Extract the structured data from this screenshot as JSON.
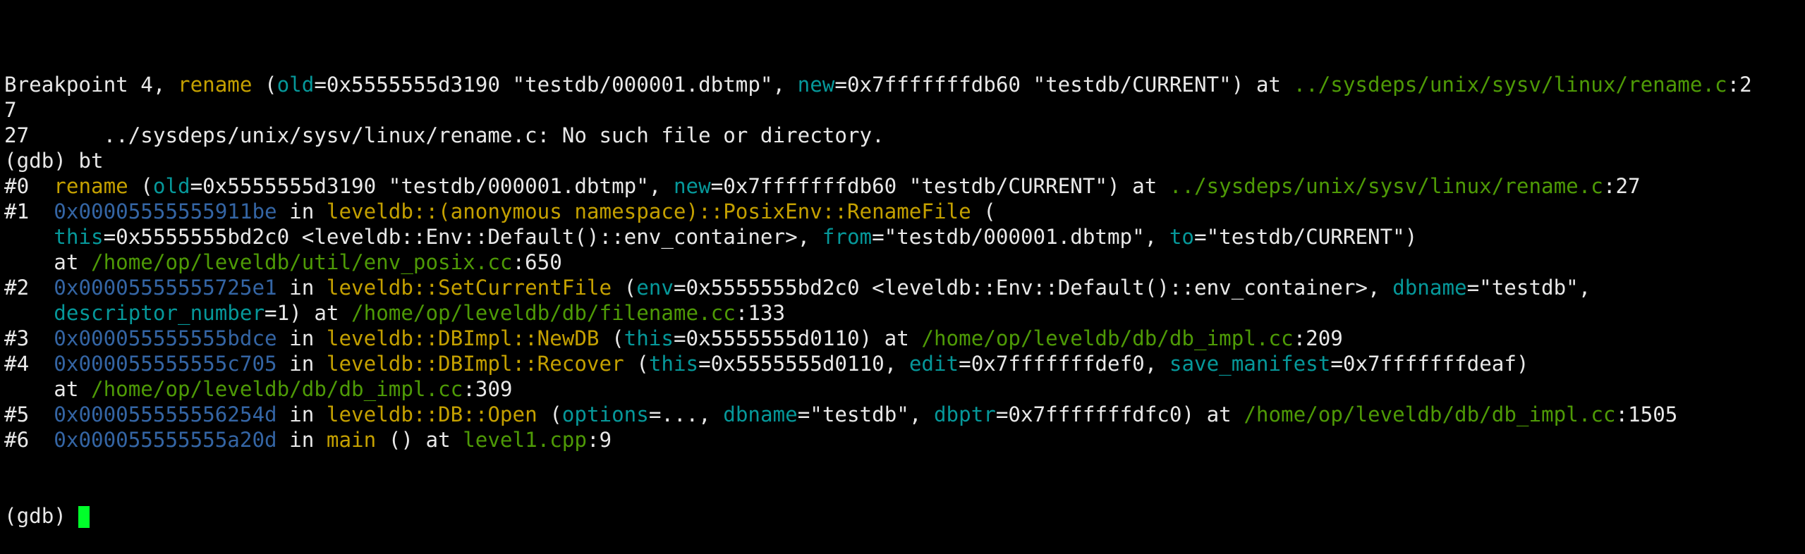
{
  "terminal": {
    "lines": [
      [
        {
          "t": "Breakpoint 4, ",
          "c": "plain"
        },
        {
          "t": "rename",
          "c": "fn"
        },
        {
          "t": " (",
          "c": "plain"
        },
        {
          "t": "old",
          "c": "arg"
        },
        {
          "t": "=0x5555555d3190 \"testdb/000001.dbtmp\", ",
          "c": "plain"
        },
        {
          "t": "new",
          "c": "arg"
        },
        {
          "t": "=0x7fffffffdb60 \"testdb/CURRENT\") at ",
          "c": "plain"
        },
        {
          "t": "../sysdeps/unix/sysv/linux/rename.c",
          "c": "file"
        },
        {
          "t": ":2",
          "c": "plain"
        }
      ],
      [
        {
          "t": "7",
          "c": "plain"
        }
      ],
      [
        {
          "t": "27\t../sysdeps/unix/sysv/linux/rename.c: No such file or directory.",
          "c": "plain"
        }
      ],
      [
        {
          "t": "(gdb) bt",
          "c": "plain"
        }
      ],
      [
        {
          "t": "#0  ",
          "c": "plain"
        },
        {
          "t": "rename",
          "c": "fn"
        },
        {
          "t": " (",
          "c": "plain"
        },
        {
          "t": "old",
          "c": "arg"
        },
        {
          "t": "=0x5555555d3190 \"testdb/000001.dbtmp\", ",
          "c": "plain"
        },
        {
          "t": "new",
          "c": "arg"
        },
        {
          "t": "=0x7fffffffdb60 \"testdb/CURRENT\") at ",
          "c": "plain"
        },
        {
          "t": "../sysdeps/unix/sysv/linux/rename.c",
          "c": "file"
        },
        {
          "t": ":27",
          "c": "plain"
        }
      ],
      [
        {
          "t": "#1  ",
          "c": "plain"
        },
        {
          "t": "0x00005555555911be",
          "c": "addr"
        },
        {
          "t": " in ",
          "c": "plain"
        },
        {
          "t": "leveldb::(anonymous namespace)::PosixEnv::RenameFile",
          "c": "fn"
        },
        {
          "t": " (",
          "c": "plain"
        }
      ],
      [
        {
          "t": "    ",
          "c": "plain"
        },
        {
          "t": "this",
          "c": "arg"
        },
        {
          "t": "=0x5555555bd2c0 <leveldb::Env::Default()::env_container>, ",
          "c": "plain"
        },
        {
          "t": "from",
          "c": "arg"
        },
        {
          "t": "=\"testdb/000001.dbtmp\", ",
          "c": "plain"
        },
        {
          "t": "to",
          "c": "arg"
        },
        {
          "t": "=\"testdb/CURRENT\")",
          "c": "plain"
        }
      ],
      [
        {
          "t": "    at ",
          "c": "plain"
        },
        {
          "t": "/home/op/leveldb/util/env_posix.cc",
          "c": "file"
        },
        {
          "t": ":650",
          "c": "plain"
        }
      ],
      [
        {
          "t": "#2  ",
          "c": "plain"
        },
        {
          "t": "0x00005555555725e1",
          "c": "addr"
        },
        {
          "t": " in ",
          "c": "plain"
        },
        {
          "t": "leveldb::SetCurrentFile",
          "c": "fn"
        },
        {
          "t": " (",
          "c": "plain"
        },
        {
          "t": "env",
          "c": "arg"
        },
        {
          "t": "=0x5555555bd2c0 <leveldb::Env::Default()::env_container>, ",
          "c": "plain"
        },
        {
          "t": "dbname",
          "c": "arg"
        },
        {
          "t": "=\"testdb\",",
          "c": "plain"
        }
      ],
      [
        {
          "t": "    ",
          "c": "plain"
        },
        {
          "t": "descriptor_number",
          "c": "arg"
        },
        {
          "t": "=1) at ",
          "c": "plain"
        },
        {
          "t": "/home/op/leveldb/db/filename.cc",
          "c": "file"
        },
        {
          "t": ":133",
          "c": "plain"
        }
      ],
      [
        {
          "t": "#3  ",
          "c": "plain"
        },
        {
          "t": "0x000055555555bdce",
          "c": "addr"
        },
        {
          "t": " in ",
          "c": "plain"
        },
        {
          "t": "leveldb::DBImpl::NewDB",
          "c": "fn"
        },
        {
          "t": " (",
          "c": "plain"
        },
        {
          "t": "this",
          "c": "arg"
        },
        {
          "t": "=0x5555555d0110) at ",
          "c": "plain"
        },
        {
          "t": "/home/op/leveldb/db/db_impl.cc",
          "c": "file"
        },
        {
          "t": ":209",
          "c": "plain"
        }
      ],
      [
        {
          "t": "#4  ",
          "c": "plain"
        },
        {
          "t": "0x000055555555c705",
          "c": "addr"
        },
        {
          "t": " in ",
          "c": "plain"
        },
        {
          "t": "leveldb::DBImpl::Recover",
          "c": "fn"
        },
        {
          "t": " (",
          "c": "plain"
        },
        {
          "t": "this",
          "c": "arg"
        },
        {
          "t": "=0x5555555d0110, ",
          "c": "plain"
        },
        {
          "t": "edit",
          "c": "arg"
        },
        {
          "t": "=0x7fffffffdef0, ",
          "c": "plain"
        },
        {
          "t": "save_manifest",
          "c": "arg"
        },
        {
          "t": "=0x7fffffffdeaf)",
          "c": "plain"
        }
      ],
      [
        {
          "t": "    at ",
          "c": "plain"
        },
        {
          "t": "/home/op/leveldb/db/db_impl.cc",
          "c": "file"
        },
        {
          "t": ":309",
          "c": "plain"
        }
      ],
      [
        {
          "t": "#5  ",
          "c": "plain"
        },
        {
          "t": "0x000055555556254d",
          "c": "addr"
        },
        {
          "t": " in ",
          "c": "plain"
        },
        {
          "t": "leveldb::DB::Open",
          "c": "fn"
        },
        {
          "t": " (",
          "c": "plain"
        },
        {
          "t": "options",
          "c": "arg"
        },
        {
          "t": "=..., ",
          "c": "plain"
        },
        {
          "t": "dbname",
          "c": "arg"
        },
        {
          "t": "=\"testdb\", ",
          "c": "plain"
        },
        {
          "t": "dbptr",
          "c": "arg"
        },
        {
          "t": "=0x7fffffffdfc0) at ",
          "c": "plain"
        },
        {
          "t": "/home/op/leveldb/db/db_impl.cc",
          "c": "file"
        },
        {
          "t": ":1505",
          "c": "plain"
        }
      ],
      [
        {
          "t": "#6  ",
          "c": "plain"
        },
        {
          "t": "0x000055555555a20d",
          "c": "addr"
        },
        {
          "t": " in ",
          "c": "plain"
        },
        {
          "t": "main",
          "c": "fn"
        },
        {
          "t": " () at ",
          "c": "plain"
        },
        {
          "t": "level1.cpp",
          "c": "file"
        },
        {
          "t": ":9",
          "c": "plain"
        }
      ]
    ],
    "prompt": "(gdb) ",
    "cursor_icon": "block-cursor"
  },
  "colors": {
    "background": "#000000",
    "foreground": "#e8e8e8",
    "function": "#c4a000",
    "argument": "#06989a",
    "address": "#3465a4",
    "filename": "#4e9a06",
    "cursor": "#00ff2a"
  }
}
